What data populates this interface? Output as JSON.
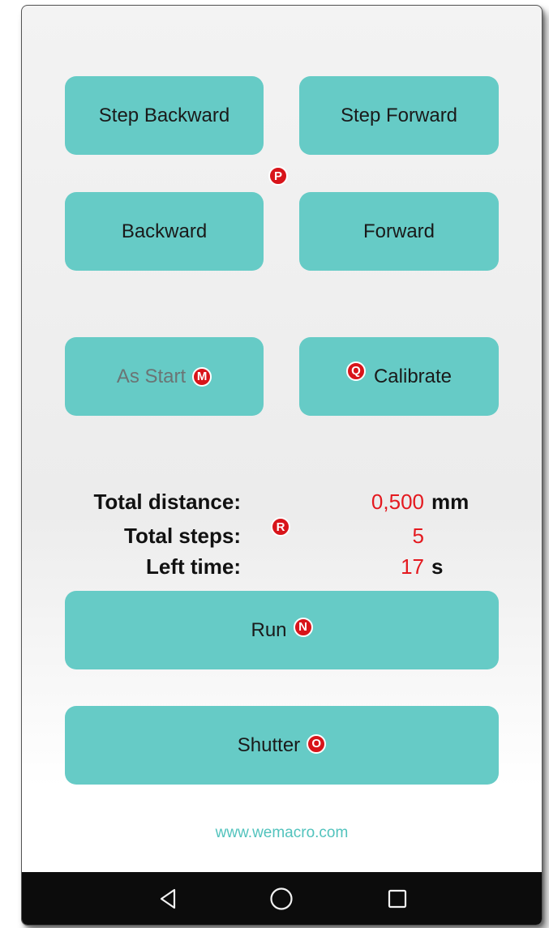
{
  "buttons": {
    "step_backward": "Step Backward",
    "step_forward": "Step Forward",
    "backward": "Backward",
    "forward": "Forward",
    "as_start": "As Start",
    "calibrate": "Calibrate",
    "run": "Run",
    "shutter": "Shutter"
  },
  "markers": {
    "p": "P",
    "m": "M",
    "q": "Q",
    "r": "R",
    "n": "N",
    "o": "O"
  },
  "info": {
    "total_distance_label": "Total distance:",
    "total_distance_value": "0,500",
    "total_distance_unit": "mm",
    "total_steps_label": "Total steps:",
    "total_steps_value": "5",
    "left_time_label": "Left time:",
    "left_time_value": "17",
    "left_time_unit": "s"
  },
  "footer": {
    "link": "www.wemacro.com"
  },
  "colors": {
    "button": "#66cbc6",
    "value_red": "#e4191f",
    "marker_red": "#d8141a",
    "link": "#52c3bd",
    "navbar": "#0c0c0c"
  },
  "icons": {
    "nav_back": "back-triangle-icon",
    "nav_home": "home-circle-icon",
    "nav_recents": "recents-square-icon"
  }
}
